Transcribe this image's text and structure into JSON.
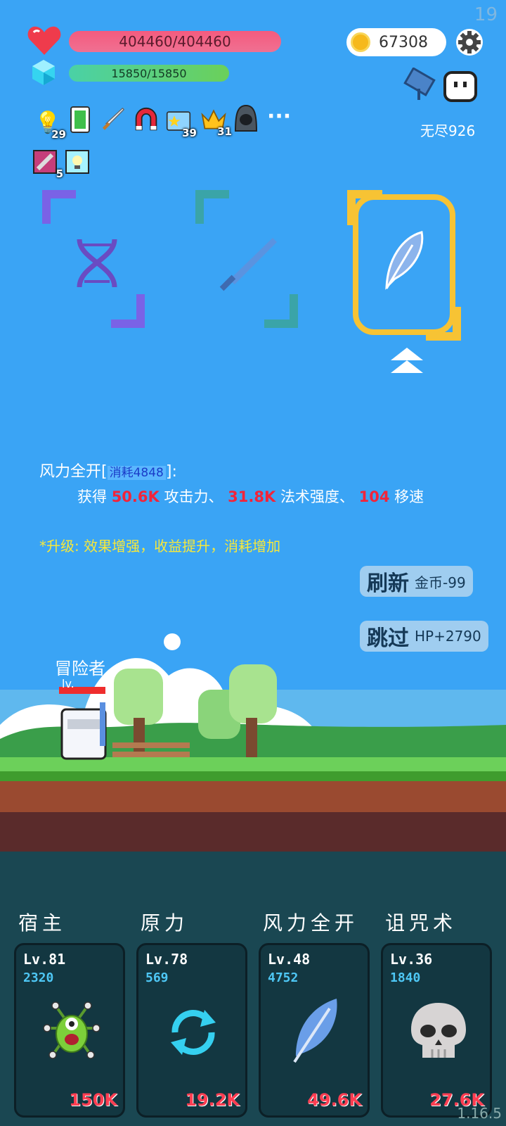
{
  "corner_number": "19",
  "hp": {
    "text": "404460/404460",
    "icon": "heart-icon"
  },
  "mp": {
    "text": "15850/15850",
    "icon": "gem-icon"
  },
  "coins": "67308",
  "mode": "无尽926",
  "buffs": [
    {
      "icon": "lightbulb-icon",
      "count": "29"
    },
    {
      "icon": "card-icon",
      "count": ""
    },
    {
      "icon": "sword-icon",
      "count": ""
    },
    {
      "icon": "magnet-icon",
      "count": ""
    },
    {
      "icon": "star-card-icon",
      "count": "39"
    },
    {
      "icon": "crown-icon",
      "count": "31"
    },
    {
      "icon": "hood-icon",
      "count": ""
    },
    {
      "icon": "more-icon",
      "count": ""
    }
  ],
  "buffs_row2": [
    {
      "icon": "scroll-icon",
      "count": "5"
    },
    {
      "icon": "light-card-icon",
      "count": ""
    }
  ],
  "more_label": "···",
  "selected_desc": {
    "name": "风力全开",
    "cost": "消耗4848",
    "line2_prefix": "获得",
    "atk": "50.6K",
    "atk_label": "攻击力、",
    "spell": "31.8K",
    "spell_label": "法术强度、",
    "speed": "104",
    "speed_label": "移速",
    "upgrade_note": "*升级: 效果增强，收益提升，消耗增加"
  },
  "refresh_button": {
    "label": "刷新",
    "cost": "金币-99"
  },
  "skip_button": {
    "label": "跳过",
    "reward": "HP+2790"
  },
  "player": {
    "name": "冒险者",
    "level": "lv."
  },
  "skills": [
    {
      "title": "宿主",
      "level": "Lv.81",
      "value": "2320",
      "cost": "150K",
      "icon": "germ-icon"
    },
    {
      "title": "原力",
      "level": "Lv.78",
      "value": "569",
      "cost": "19.2K",
      "icon": "cycle-icon"
    },
    {
      "title": "风力全开",
      "level": "Lv.48",
      "value": "4752",
      "cost": "49.6K",
      "icon": "feather-icon"
    },
    {
      "title": "诅咒术",
      "level": "Lv.36",
      "value": "1840",
      "cost": "27.6K",
      "icon": "skull-icon"
    }
  ],
  "version": "1.16.5",
  "colors": {
    "sky": "#3aa4f5",
    "hp": "#f45b7e",
    "mp": "#4ad1a6",
    "highlight": "#f7c334",
    "cost_red": "#ff3e52"
  }
}
